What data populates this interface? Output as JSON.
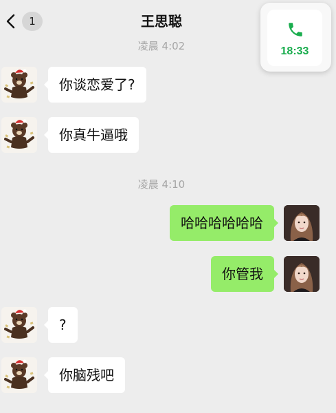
{
  "header": {
    "title": "王思聪",
    "unread_count": "1",
    "icons": {
      "back": "chevron-left-icon"
    }
  },
  "call_float": {
    "icon": "phone-icon",
    "duration": "18:33",
    "color": "#1aad4e"
  },
  "chat": {
    "timestamps": [
      "凌晨 4:02",
      "凌晨 4:10"
    ],
    "messages": [
      {
        "side": "incoming",
        "text": "你谈恋爱了?"
      },
      {
        "side": "incoming",
        "text": "你真牛逼哦"
      },
      {
        "side": "outgoing",
        "text": "哈哈哈哈哈哈"
      },
      {
        "side": "outgoing",
        "text": "你管我"
      },
      {
        "side": "incoming",
        "text": "?"
      },
      {
        "side": "incoming",
        "text": "你脑残吧"
      }
    ]
  },
  "colors": {
    "background": "#ededed",
    "outgoing_bubble": "#95ec69",
    "incoming_bubble": "#ffffff",
    "timestamp_text": "#a5a5a5"
  }
}
